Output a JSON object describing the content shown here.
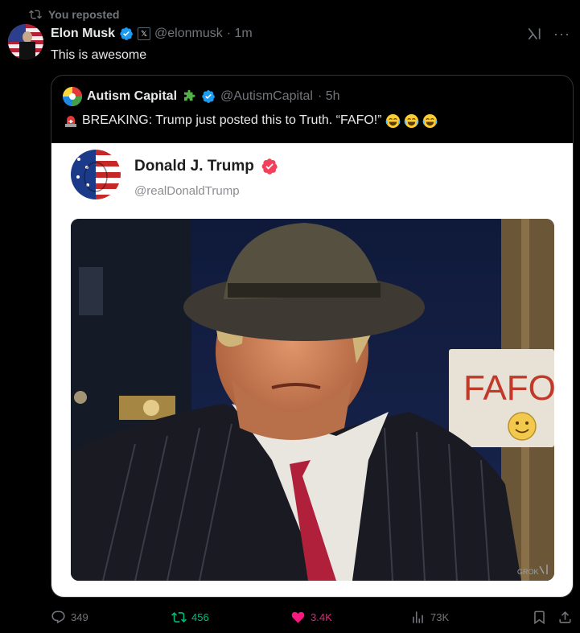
{
  "repost": {
    "label": "You reposted"
  },
  "tweet": {
    "author_name": "Elon Musk",
    "handle": "@elonmusk",
    "time": "· 1m",
    "text": "This is awesome",
    "affiliate_badge": "𝕏"
  },
  "quote": {
    "author_name": "Autism Capital",
    "handle": "@AutismCapital",
    "time": "· 5h",
    "text": "BREAKING: Trump just posted this to Truth. “FAFO!”"
  },
  "truth_card": {
    "name": "Donald J. Trump",
    "handle": "@realDonaldTrump",
    "sign_text": "FAFO",
    "watermark": "GROK"
  },
  "actions": {
    "replies": "349",
    "reposts": "456",
    "likes": "3.4K",
    "views": "73K"
  },
  "colors": {
    "background": "#000000",
    "verified_blue": "#1d9bf0",
    "repost_green": "#00ba7c",
    "like_pink": "#f91880",
    "truth_badge": "#f0425a"
  },
  "icons": [
    "repost-icon",
    "verified-icon",
    "x-affiliate-icon",
    "grok-icon",
    "more-icon",
    "siren-icon",
    "laughing-emoji-icon",
    "reply-icon",
    "heart-icon",
    "views-icon",
    "bookmark-icon",
    "share-icon"
  ]
}
